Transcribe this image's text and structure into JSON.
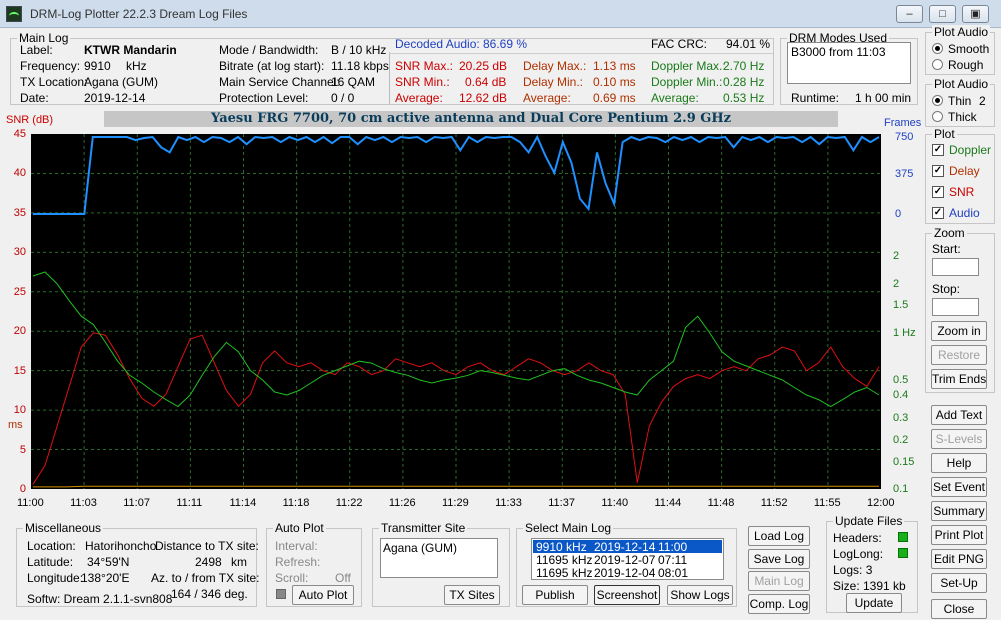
{
  "window": {
    "title": "DRM-Log Plotter 22.2.3   Dream Log Files"
  },
  "main_log": {
    "caption": "Main Log",
    "label_key": "Label:",
    "label_val": "KTWR  Mandarin",
    "freq_key": "Frequency:",
    "freq_val": "9910",
    "freq_unit": "kHz",
    "txloc_key": "TX Location:",
    "txloc_val": "Agana (GUM)",
    "date_key": "Date:",
    "date_val": "2019-12-14",
    "mode_key": "Mode / Bandwidth:",
    "mode_val": "B / 10 kHz",
    "bitrate_key": "Bitrate (at log start):",
    "bitrate_val": "11.18 kbps",
    "msc_key": "Main Service Channel:",
    "msc_val": "16  QAM",
    "prot_key": "Protection Level:",
    "prot_val": "0 / 0",
    "audio_key": "Decoded Audio:",
    "audio_val": "86.69 %",
    "fac_key": "FAC  CRC:",
    "fac_val": "94.01 %",
    "snrmax_key": "SNR Max.:",
    "snrmax_val": "20.25  dB",
    "snrmin_key": "SNR Min.:",
    "snrmin_val": "0.64  dB",
    "snravg_key": "Average:",
    "snravg_val": "12.62  dB",
    "dmax_key": "Delay Max.:",
    "dmax_val": "1.13   ms",
    "dmin_key": "Delay Min.:",
    "dmin_val": "0.10   ms",
    "davg_key": "Average:",
    "davg_val": "0.69   ms",
    "dopmax_key": "Doppler Max.:",
    "dopmax_val": "2.70 Hz",
    "dopmin_key": "Doppler Min.:",
    "dopmin_val": "0.28 Hz",
    "dopavg_key": "Average:",
    "dopavg_val": "0.53 Hz"
  },
  "drm_modes": {
    "caption": "DRM Modes Used",
    "entry": "B3000 from 11:03",
    "runtime_key": "Runtime:",
    "runtime_val": "1 h 00 min"
  },
  "plot_audio_1": {
    "caption": "Plot Audio",
    "opt1": "Smooth",
    "opt2": "Rough",
    "selected": "Smooth"
  },
  "plot_audio_2": {
    "caption": "Plot Audio",
    "opt1": "Thin",
    "opt2": "Thick",
    "value": "2",
    "selected": "Thin"
  },
  "plot_group": {
    "caption": "Plot",
    "doppler": "Doppler",
    "delay": "Delay",
    "snr": "SNR",
    "audio": "Audio"
  },
  "zoom": {
    "caption": "Zoom",
    "start": "Start:",
    "stop": "Stop:",
    "zoom_in": "Zoom in",
    "restore": "Restore",
    "trim": "Trim Ends"
  },
  "side_buttons": {
    "add_text": "Add Text",
    "s_levels": "S-Levels",
    "help": "Help",
    "set_event": "Set Event",
    "summary": "Summary",
    "print_plot": "Print Plot",
    "edit_png": "Edit PNG",
    "setup": "Set-Up",
    "close": "Close"
  },
  "banner": "Yaesu FRG 7700, 70 cm active antenna and Dual Core Pentium 2.9 GHz",
  "chart_data": {
    "type": "line",
    "x_labels": [
      "11:00",
      "11:03",
      "11:07",
      "11:11",
      "11:14",
      "11:18",
      "11:22",
      "11:26",
      "11:29",
      "11:33",
      "11:37",
      "11:40",
      "11:44",
      "11:48",
      "11:52",
      "11:55",
      "12:00"
    ],
    "snr_axis": {
      "label": "SNR (dB)",
      "ticks": [
        "45",
        "40",
        "35",
        "30",
        "25",
        "20",
        "15",
        "10",
        "5",
        "0"
      ]
    },
    "ms_label": "ms",
    "frames_axis": {
      "label": "Frames",
      "ticks": [
        "750",
        "375",
        "0"
      ]
    },
    "hz_axis": {
      "ticks": [
        "2",
        "1.5",
        "1 Hz",
        "0.5",
        "0.4",
        "0.3",
        "0.2",
        "0.15",
        "0.1"
      ]
    },
    "colors": {
      "snr": "#e01010",
      "doppler": "#20c020",
      "delay": "#d09000",
      "audio": "#1e90ff",
      "plot_bg": "#000000",
      "grid": "#2a6a2a"
    },
    "series": [
      {
        "name": "SNR",
        "values": [
          0.6,
          3,
          8,
          13,
          18,
          19.8,
          19.5,
          17,
          14,
          11.5,
          10.5,
          12,
          15.5,
          19,
          19.5,
          16,
          12.5,
          10.5,
          12,
          16,
          17.5,
          16,
          15.5,
          16,
          15,
          14.5,
          16,
          15.5,
          14.5,
          15,
          16.5,
          16,
          15.5,
          16,
          15,
          14.5,
          15.5,
          16,
          15,
          14.5,
          15.5,
          16.5,
          16,
          15,
          14.5,
          15,
          16,
          15,
          14.5,
          12,
          0.8,
          8,
          11,
          13,
          14,
          14.5,
          14,
          15,
          15.5,
          15,
          16.5,
          17,
          18,
          17.5,
          15,
          16,
          18,
          15.5,
          14,
          13,
          15.5
        ]
      },
      {
        "name": "Doppler",
        "values": [
          2.2,
          2.3,
          2.0,
          1.6,
          1.3,
          1.15,
          0.9,
          0.7,
          0.55,
          0.48,
          0.42,
          0.38,
          0.35,
          0.4,
          0.55,
          0.75,
          0.9,
          0.8,
          0.6,
          0.5,
          0.42,
          0.4,
          0.43,
          0.48,
          0.55,
          0.6,
          0.65,
          0.7,
          0.68,
          0.62,
          0.58,
          0.55,
          0.5,
          0.48,
          0.5,
          0.52,
          0.55,
          0.6,
          0.58,
          0.55,
          0.52,
          0.5,
          0.55,
          0.6,
          0.62,
          0.55,
          0.5,
          0.48,
          0.45,
          0.42,
          0.4,
          0.5,
          0.6,
          0.7,
          1.1,
          1.3,
          1.0,
          0.8,
          0.7,
          0.65,
          0.6,
          0.55,
          0.5,
          0.45,
          0.4,
          0.38,
          0.35,
          0.38,
          0.42,
          0.45,
          0.4
        ]
      },
      {
        "name": "Delay",
        "values": [
          0.3,
          0.3,
          0.3,
          0.4,
          0.4,
          0.4,
          0.4,
          0.4,
          0.4,
          0.4,
          0.4,
          0.4,
          0.4,
          0.4,
          0.4,
          0.4,
          0.4,
          0.4,
          0.4,
          0.4,
          0.4,
          0.4,
          0.4,
          0.4,
          0.4,
          0.4,
          0.4,
          0.4,
          0.4,
          0.4,
          0.4,
          0.4,
          0.4,
          0.4,
          0.4,
          0.4,
          0.4,
          0.4,
          0.4,
          0.4,
          0.4,
          0.4,
          0.4,
          0.4,
          0.4,
          0.4,
          0.4,
          0.4,
          0.4,
          0.4,
          0.4
        ]
      },
      {
        "name": "Audio",
        "values": [
          0,
          0,
          0,
          0,
          0,
          0,
          0,
          750,
          750,
          750,
          750,
          750,
          720,
          740,
          750,
          650,
          600,
          750,
          720,
          750,
          700,
          750,
          740,
          700,
          750,
          680,
          750,
          740,
          750,
          700,
          750,
          720,
          750,
          700,
          750,
          690,
          750,
          750,
          680,
          750,
          720,
          750,
          700,
          750,
          740,
          750,
          700,
          750,
          740,
          750,
          620,
          750,
          700,
          750,
          740,
          750,
          750,
          700,
          600,
          750,
          560,
          400,
          700,
          500,
          150,
          50,
          600,
          300,
          100,
          700,
          750,
          720,
          750,
          740,
          700,
          750,
          720,
          750,
          700,
          750,
          740,
          750,
          650,
          750,
          720,
          750,
          700,
          750,
          740,
          750,
          700,
          750,
          680,
          750,
          740,
          750,
          620,
          750,
          700,
          750
        ]
      }
    ]
  },
  "misc": {
    "caption": "Miscellaneous",
    "location_key": "Location:",
    "location_val": "Hatorihoncho",
    "lat_key": "Latitude:",
    "lat_val": "34°59'N",
    "lon_key": "Longitude:",
    "lon_val": "138°20'E",
    "dist_key": "Distance to TX site:",
    "dist_val": "2498",
    "dist_unit": "km",
    "az_key": "Az. to / from TX site:",
    "az_val": "164 / 346  deg.",
    "softw": "Softw: Dream 2.1.1-svn808"
  },
  "auto_plot": {
    "caption": "Auto Plot",
    "interval": "Interval:",
    "refresh": "Refresh:",
    "scroll": "Scroll:",
    "scroll_val": "Off",
    "button": "Auto Plot"
  },
  "tx_site": {
    "caption": "Transmitter Site",
    "entry": "Agana (GUM)",
    "button": "TX Sites"
  },
  "select_log": {
    "caption": "Select Main Log",
    "rows": [
      {
        "f": "9910 kHz",
        "d": "2019-12-14",
        "t": "11:00"
      },
      {
        "f": "11695 kHz",
        "d": "2019-12-07",
        "t": "07:11"
      },
      {
        "f": "11695 kHz",
        "d": "2019-12-04",
        "t": "08:01"
      }
    ],
    "publish": "Publish",
    "screenshot": "Screenshot",
    "show_logs": "Show Logs"
  },
  "log_buttons": {
    "load": "Load Log",
    "save": "Save Log",
    "main": "Main Log",
    "comp": "Comp. Log"
  },
  "update_files": {
    "caption": "Update Files",
    "headers": "Headers:",
    "loglong": "LogLong:",
    "logs": "Logs: 3",
    "size": "Size:  1391 kb",
    "update": "Update"
  }
}
